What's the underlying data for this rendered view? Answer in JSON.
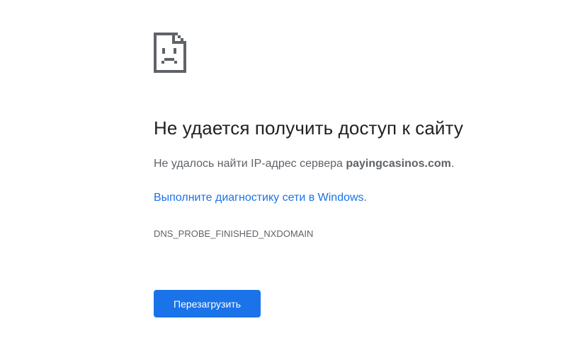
{
  "icon": {
    "name": "sad-page-icon",
    "color": "#5f6368"
  },
  "error": {
    "title": "Не удается получить доступ к сайту",
    "description_prefix": "Не удалось найти IP-адрес сервера ",
    "domain": "payingcasinos.com",
    "description_suffix": ".",
    "diagnose_link": "Выполните диагностику сети в Windows",
    "diagnose_suffix": ".",
    "code": "DNS_PROBE_FINISHED_NXDOMAIN"
  },
  "actions": {
    "reload_label": "Перезагрузить"
  },
  "colors": {
    "accent": "#1a73e8",
    "text": "#202124",
    "secondary_text": "#5f6368",
    "background": "#ffffff"
  }
}
